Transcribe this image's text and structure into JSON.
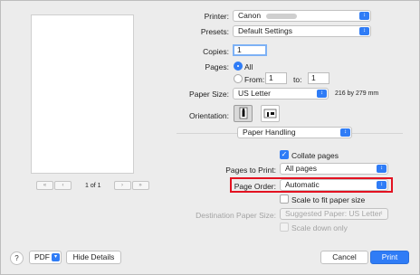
{
  "preview": {
    "page_counter": "1 of 1"
  },
  "printer": {
    "label": "Printer:",
    "value": "Canon"
  },
  "presets": {
    "label": "Presets:",
    "value": "Default Settings"
  },
  "copies": {
    "label": "Copies:",
    "value": "1"
  },
  "pages": {
    "label": "Pages:",
    "all_label": "All",
    "from_label": "From:",
    "from_value": "1",
    "to_label": "to:",
    "to_value": "1"
  },
  "paper_size": {
    "label": "Paper Size:",
    "value": "US Letter",
    "dimensions": "216 by 279 mm"
  },
  "orientation": {
    "label": "Orientation:"
  },
  "section": {
    "value": "Paper Handling"
  },
  "collate": {
    "label": "Collate pages",
    "checked": true
  },
  "pages_to_print": {
    "label": "Pages to Print:",
    "value": "All pages"
  },
  "page_order": {
    "label": "Page Order:",
    "value": "Automatic"
  },
  "scale_to_fit": {
    "label": "Scale to fit paper size",
    "checked": false
  },
  "destination": {
    "label": "Destination Paper Size:",
    "value": "Suggested Paper: US Letter"
  },
  "scale_down": {
    "label": "Scale down only"
  },
  "footer": {
    "help": "?",
    "pdf": "PDF",
    "hide_details": "Hide Details",
    "cancel": "Cancel",
    "print": "Print"
  },
  "colors": {
    "accent": "#2f7cf6",
    "highlight": "#e31221"
  }
}
